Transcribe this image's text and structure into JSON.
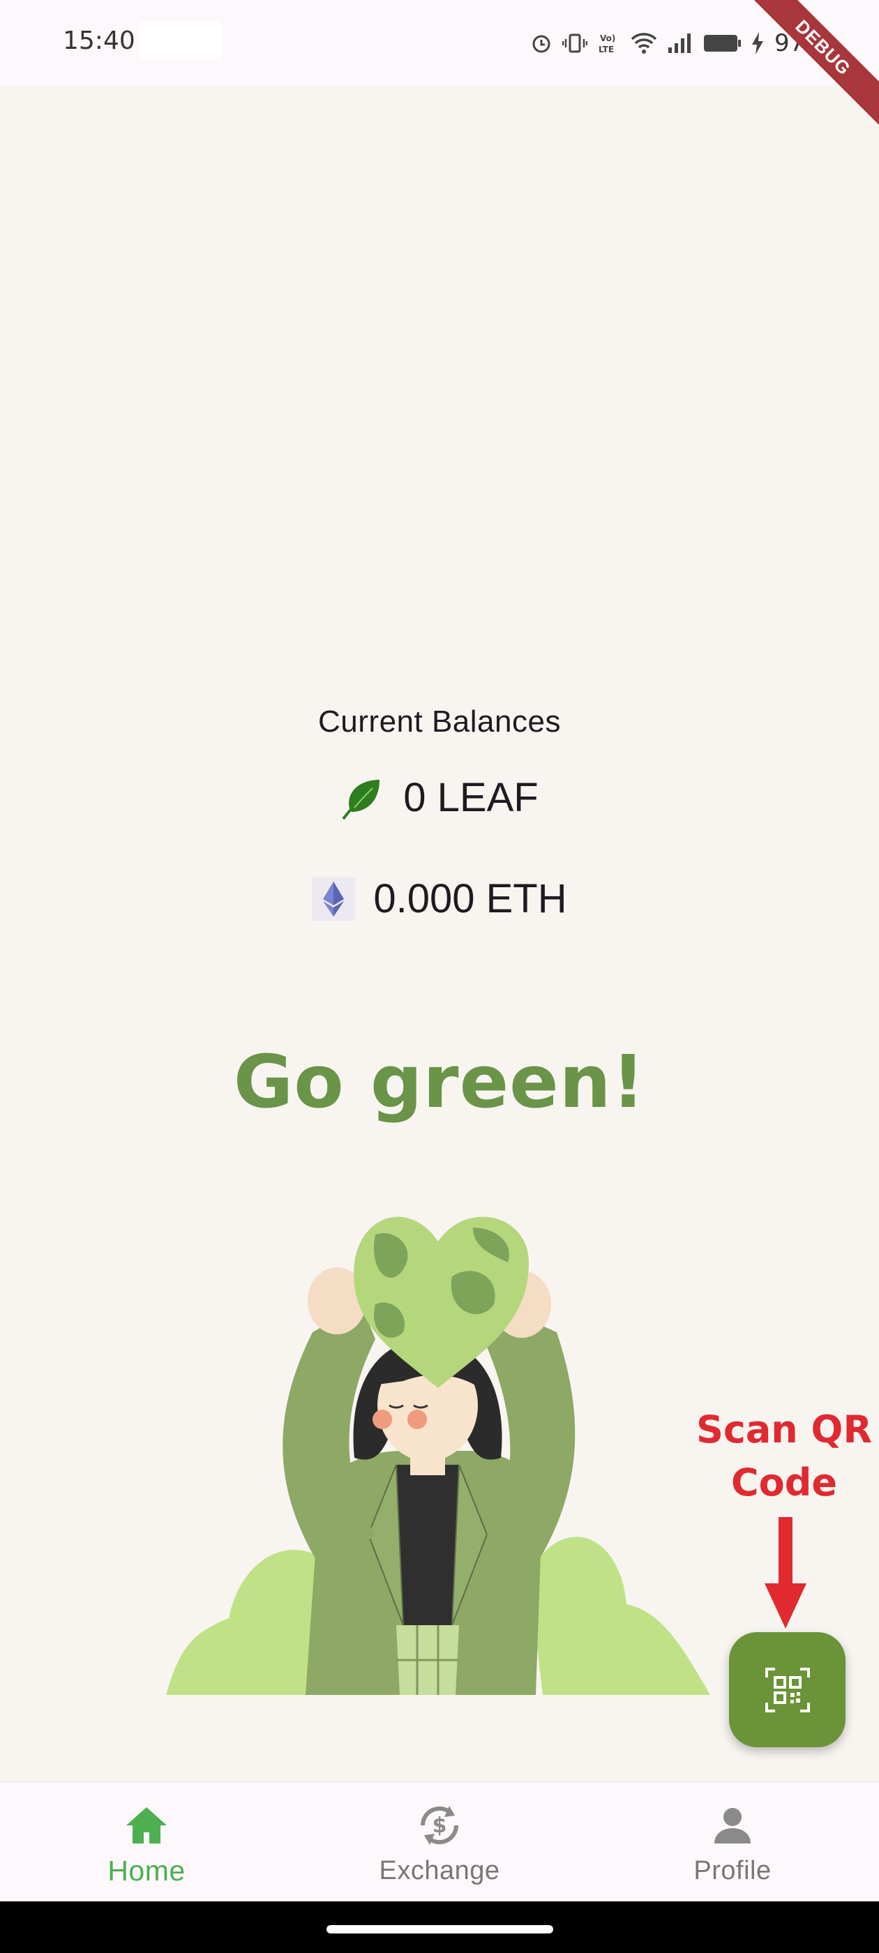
{
  "status_bar": {
    "time": "15:40",
    "battery_percent": "97%",
    "debug_label": "DEBUG",
    "icons": [
      "alarm-icon",
      "vibrate-icon",
      "volte-icon",
      "wifi-icon",
      "signal-icon",
      "battery-icon",
      "charging-icon"
    ]
  },
  "balances": {
    "title": "Current Balances",
    "leaf": {
      "icon": "leaf-icon",
      "value": "0 LEAF"
    },
    "eth": {
      "icon": "ethereum-icon",
      "value": "0.000 ETH"
    }
  },
  "headline": "Go green!",
  "illustration": {
    "icon": "woman-holding-earth-heart-illustration"
  },
  "scan": {
    "label_line1": "Scan QR",
    "label_line2": "Code",
    "button_icon": "qr-scan-icon"
  },
  "colors": {
    "background": "#f8f5f1",
    "accent_green": "#6a9437",
    "nav_active": "#4caf50",
    "annotation_red": "#e02a2f"
  },
  "bottom_nav": {
    "items": [
      {
        "label": "Home",
        "icon": "home-icon",
        "active": true
      },
      {
        "label": "Exchange",
        "icon": "exchange-icon",
        "active": false
      },
      {
        "label": "Profile",
        "icon": "profile-icon",
        "active": false
      }
    ]
  }
}
